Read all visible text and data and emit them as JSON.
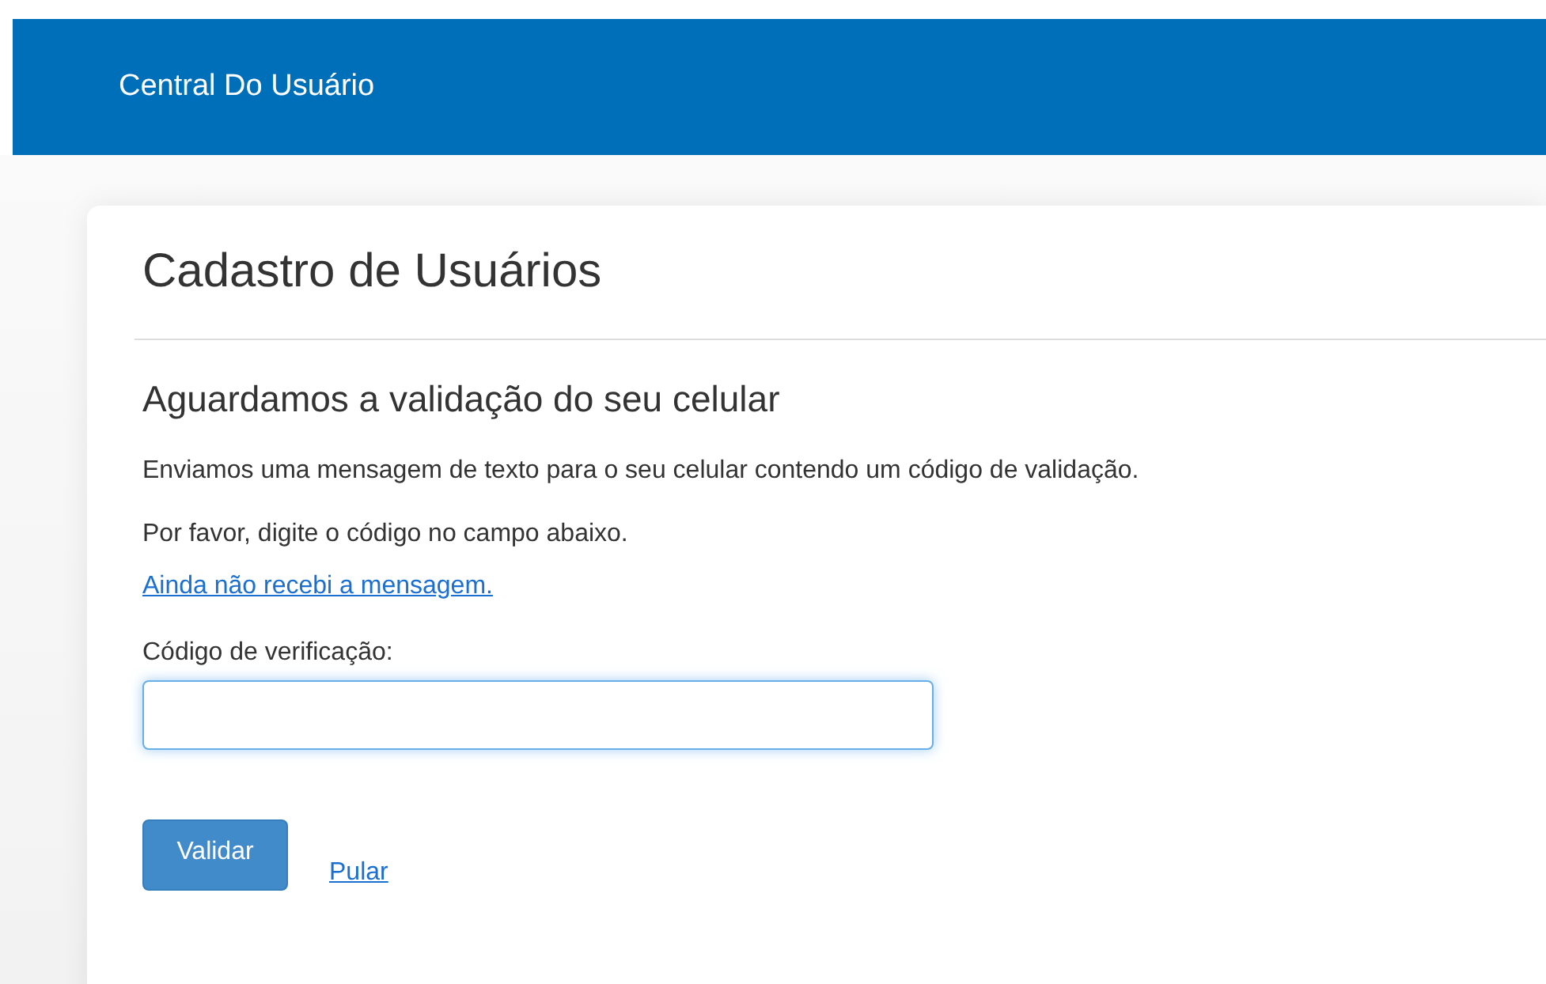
{
  "header": {
    "title": "Central Do Usuário"
  },
  "card": {
    "title": "Cadastro de Usuários",
    "subtitle": "Aguardamos a validação do seu celular",
    "paragraphs": [
      "Enviamos uma mensagem de texto para o seu celular contendo um código de validação.",
      "Por favor, digite o código no campo abaixo."
    ],
    "resend_link": "Ainda não recebi a mensagem.",
    "field": {
      "label": "Código de verificação:",
      "focused": true
    },
    "buttons": {
      "submit": "Validar",
      "skip": "Pular"
    }
  }
}
